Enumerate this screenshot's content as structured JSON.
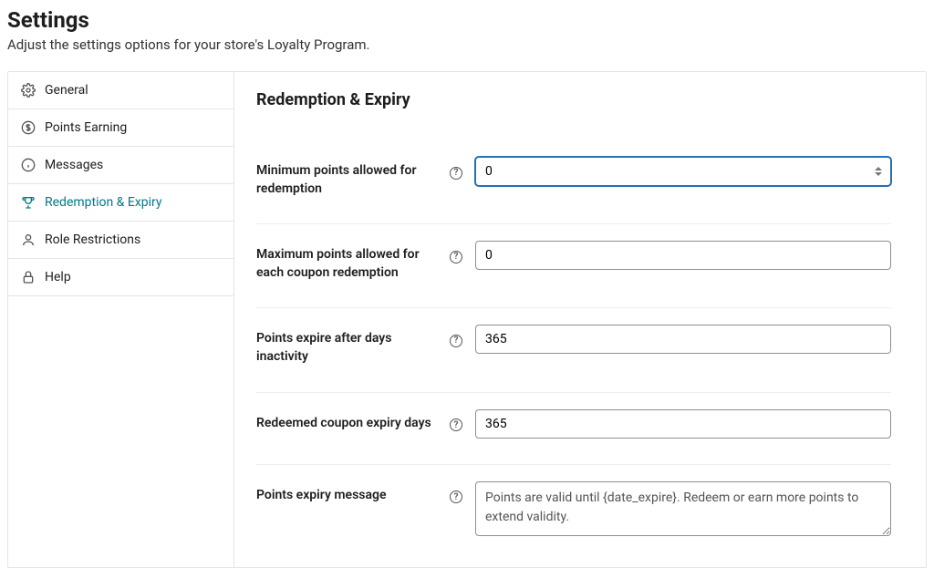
{
  "page": {
    "title": "Settings",
    "subtitle": "Adjust the settings options for your store's Loyalty Program."
  },
  "sidebar": {
    "items": [
      {
        "label": "General",
        "icon": "gear-icon"
      },
      {
        "label": "Points Earning",
        "icon": "dollar-icon"
      },
      {
        "label": "Messages",
        "icon": "info-icon"
      },
      {
        "label": "Redemption & Expiry",
        "icon": "trophy-icon",
        "active": true
      },
      {
        "label": "Role Restrictions",
        "icon": "person-icon"
      },
      {
        "label": "Help",
        "icon": "lock-icon"
      }
    ]
  },
  "section": {
    "title": "Redemption & Expiry"
  },
  "fields": {
    "min_points": {
      "label": "Minimum points allowed for redemption",
      "value": "0"
    },
    "max_points": {
      "label": "Maximum points allowed for each coupon redemption",
      "value": "0"
    },
    "expire_days": {
      "label": "Points expire after days inactivity",
      "value": "365"
    },
    "coupon_expiry": {
      "label": "Redeemed coupon expiry days",
      "value": "365"
    },
    "expiry_msg": {
      "label": "Points expiry message",
      "value": "Points are valid until {date_expire}. Redeem or earn more points to extend validity."
    }
  }
}
